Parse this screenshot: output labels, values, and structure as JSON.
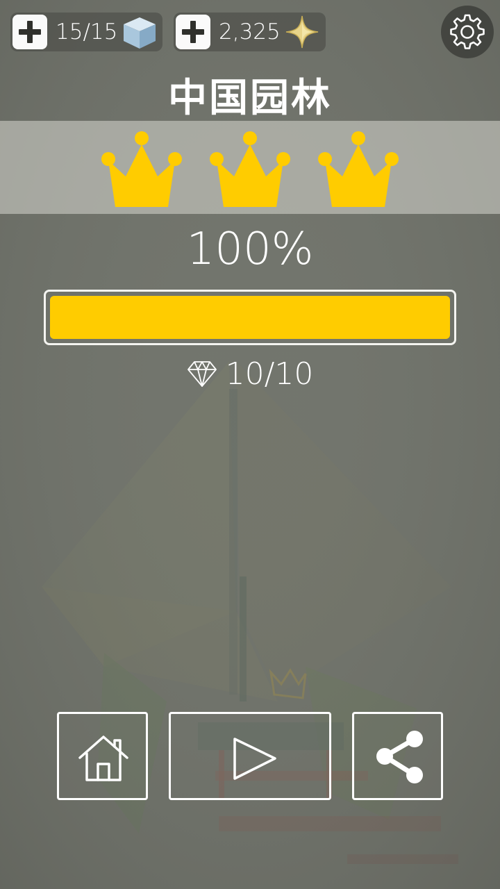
{
  "hud": {
    "lives": {
      "value": "15/15",
      "add_icon": "plus-icon",
      "icon": "ice-cube-icon"
    },
    "stars": {
      "value": "2,325",
      "add_icon": "plus-icon",
      "icon": "sparkle-star-icon"
    },
    "settings_icon": "gear-icon"
  },
  "level": {
    "title": "中国园林",
    "crowns_earned": 3,
    "crowns_total": 3,
    "percent_label": "100%",
    "progress_fraction": 1.0,
    "gems": {
      "icon": "diamond-icon",
      "value": "10/10"
    }
  },
  "actions": [
    {
      "name": "home",
      "icon": "home-icon"
    },
    {
      "name": "play",
      "icon": "play-icon"
    },
    {
      "name": "share",
      "icon": "share-icon"
    }
  ],
  "colors": {
    "accent_yellow": "#ffcc00",
    "background": "#6f726a",
    "text": "#ffffff"
  }
}
